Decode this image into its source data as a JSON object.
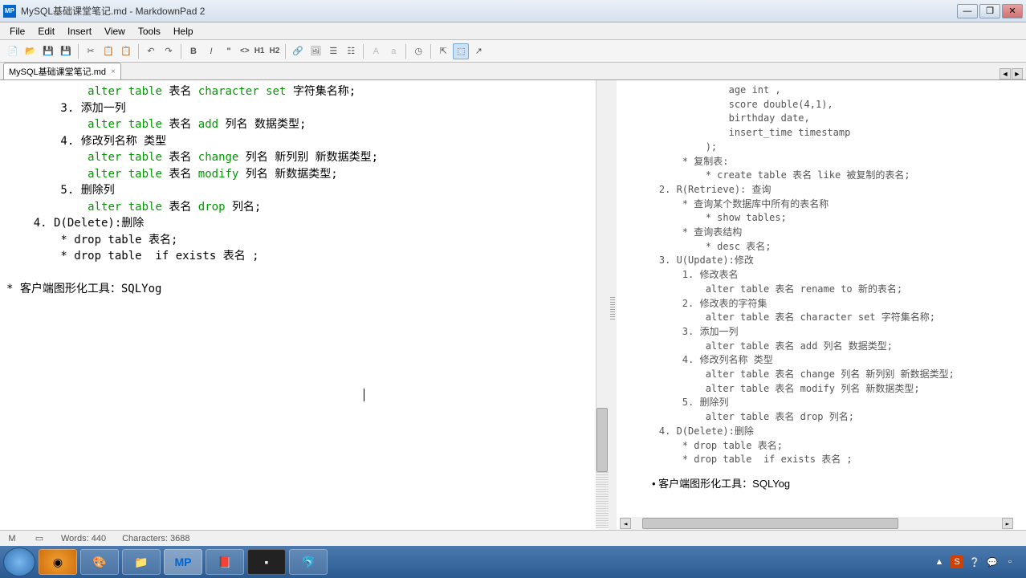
{
  "title": "MySQL基础课堂笔记.md - MarkdownPad 2",
  "app_badge": "MP",
  "menu": {
    "file": "File",
    "edit": "Edit",
    "insert": "Insert",
    "view": "View",
    "tools": "Tools",
    "help": "Help"
  },
  "tab": {
    "name": "MySQL基础课堂笔记.md",
    "close": "×"
  },
  "tabnav": {
    "left": "◄",
    "right": "►"
  },
  "editor": {
    "l1_indent": "            ",
    "l1_a": "alter",
    "l1_b": "table",
    "l1_c": "表名",
    "l1_d": "character",
    "l1_e": "set",
    "l1_f": "字符集名称;",
    "l2": "        3. 添加一列",
    "l3_indent": "            ",
    "l3_a": "alter",
    "l3_b": "table",
    "l3_c": "表名",
    "l3_d": "add",
    "l3_e": "列名 数据类型;",
    "l4": "        4. 修改列名称 类型",
    "l5_indent": "            ",
    "l5_a": "alter",
    "l5_b": "table",
    "l5_c": "表名",
    "l5_d": "change",
    "l5_e": "列名 新列别 新数据类型;",
    "l6_indent": "            ",
    "l6_a": "alter",
    "l6_b": "table",
    "l6_c": "表名",
    "l6_d": "modify",
    "l6_e": "列名 新数据类型;",
    "l7": "        5. 删除列",
    "l8_indent": "            ",
    "l8_a": "alter",
    "l8_b": "table",
    "l8_c": "表名",
    "l8_d": "drop",
    "l8_e": "列名;",
    "l9": "    4. D(Delete):删除",
    "l10": "        * drop table 表名;",
    "l11": "        * drop table  if exists 表名 ;",
    "l12": "",
    "l13": "* 客户端图形化工具：SQLYog"
  },
  "preview": {
    "p1": "                age int ,",
    "p2": "                score double(4,1),",
    "p3": "                birthday date,",
    "p4": "                insert_time timestamp",
    "p5": "            );",
    "p6": "        * 复制表:",
    "p7": "            * create table 表名 like 被复制的表名;",
    "p8": "    2. R(Retrieve): 查询",
    "p9": "        * 查询某个数据库中所有的表名称",
    "p10": "            * show tables;",
    "p11": "        * 查询表结构",
    "p12": "            * desc 表名;",
    "p13": "    3. U(Update):修改",
    "p14": "        1. 修改表名",
    "p15": "            alter table 表名 rename to 新的表名;",
    "p16": "        2. 修改表的字符集",
    "p17": "            alter table 表名 character set 字符集名称;",
    "p18": "        3. 添加一列",
    "p19": "            alter table 表名 add 列名 数据类型;",
    "p20": "        4. 修改列名称 类型",
    "p21": "            alter table 表名 change 列名 新列别 新数据类型;",
    "p22": "            alter table 表名 modify 列名 新数据类型;",
    "p23": "        5. 删除列",
    "p24": "            alter table 表名 drop 列名;",
    "p25": "    4. D(Delete):删除",
    "p26": "        * drop table 表名;",
    "p27": "        * drop table  if exists 表名 ;",
    "bullet": "客户端图形化工具：SQLYog"
  },
  "status": {
    "words_label": "Words:",
    "words_value": "440",
    "chars_label": "Characters:",
    "chars_value": "3688"
  },
  "hscroll": {
    "left": "◄",
    "right": "►"
  },
  "win": {
    "min": "—",
    "max": "❐",
    "close": "✕"
  }
}
